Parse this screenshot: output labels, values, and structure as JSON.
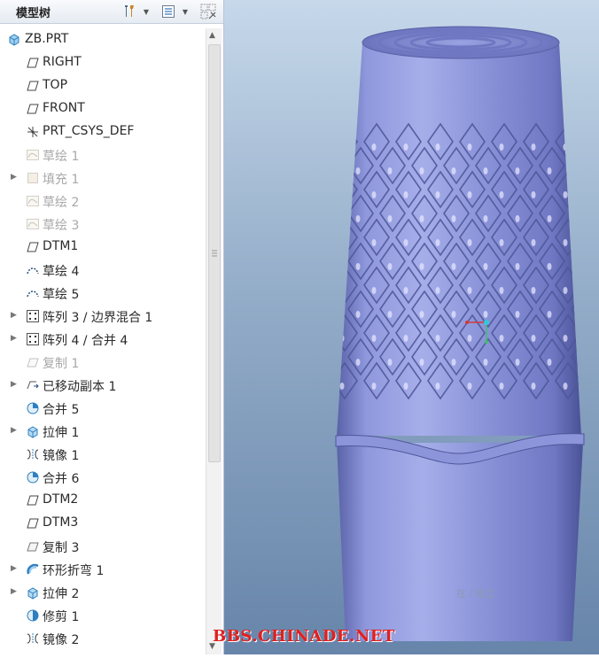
{
  "panel": {
    "title": "模型树"
  },
  "tree": {
    "root": "ZB.PRT",
    "items": [
      {
        "label": "RIGHT",
        "icon": "datum-plane-icon",
        "arrow": false,
        "dim": false
      },
      {
        "label": "TOP",
        "icon": "datum-plane-icon",
        "arrow": false,
        "dim": false
      },
      {
        "label": "FRONT",
        "icon": "datum-plane-icon",
        "arrow": false,
        "dim": false
      },
      {
        "label": "PRT_CSYS_DEF",
        "icon": "csys-icon",
        "arrow": false,
        "dim": false
      },
      {
        "label": "草绘 1",
        "icon": "sketch-icon",
        "arrow": false,
        "dim": true
      },
      {
        "label": "填充 1",
        "icon": "fill-icon",
        "arrow": true,
        "dim": true
      },
      {
        "label": "草绘 2",
        "icon": "sketch-icon",
        "arrow": false,
        "dim": true
      },
      {
        "label": "草绘 3",
        "icon": "sketch-icon",
        "arrow": false,
        "dim": true
      },
      {
        "label": "DTM1",
        "icon": "datum-plane-icon",
        "arrow": false,
        "dim": false
      },
      {
        "label": "草绘 4",
        "icon": "sketch-curve-icon",
        "arrow": false,
        "dim": false
      },
      {
        "label": "草绘 5",
        "icon": "sketch-curve-icon",
        "arrow": false,
        "dim": false
      },
      {
        "label": "阵列 3 / 边界混合 1",
        "icon": "pattern-icon",
        "arrow": true,
        "dim": false
      },
      {
        "label": "阵列 4 / 合并 4",
        "icon": "pattern-icon",
        "arrow": true,
        "dim": false
      },
      {
        "label": "复制 1",
        "icon": "copy-icon",
        "arrow": false,
        "dim": true
      },
      {
        "label": "已移动副本 1",
        "icon": "moved-copy-icon",
        "arrow": true,
        "dim": false
      },
      {
        "label": "合并 5",
        "icon": "merge-icon",
        "arrow": false,
        "dim": false
      },
      {
        "label": "拉伸 1",
        "icon": "extrude-icon",
        "arrow": true,
        "dim": false
      },
      {
        "label": "镜像 1",
        "icon": "mirror-icon",
        "arrow": false,
        "dim": false
      },
      {
        "label": "合并 6",
        "icon": "merge-icon",
        "arrow": false,
        "dim": false
      },
      {
        "label": "DTM2",
        "icon": "datum-plane-icon",
        "arrow": false,
        "dim": false
      },
      {
        "label": "DTM3",
        "icon": "datum-plane-icon",
        "arrow": false,
        "dim": false
      },
      {
        "label": "复制 3",
        "icon": "copy-icon",
        "arrow": false,
        "dim": false
      },
      {
        "label": "环形折弯 1",
        "icon": "toroidal-bend-icon",
        "arrow": true,
        "dim": false
      },
      {
        "label": "拉伸 2",
        "icon": "extrude-icon",
        "arrow": true,
        "dim": false
      },
      {
        "label": "修剪 1",
        "icon": "trim-icon",
        "arrow": false,
        "dim": false
      },
      {
        "label": "镜像 2",
        "icon": "mirror-icon",
        "arrow": false,
        "dim": false
      }
    ]
  },
  "viewport": {
    "hint": "在 / 视立",
    "watermark": "BBS.CHINADE.NET"
  },
  "colors": {
    "model": "#8d97dc",
    "background_top": "#c6d8ea",
    "background_bottom": "#6785aa",
    "watermark": "#e02020"
  }
}
